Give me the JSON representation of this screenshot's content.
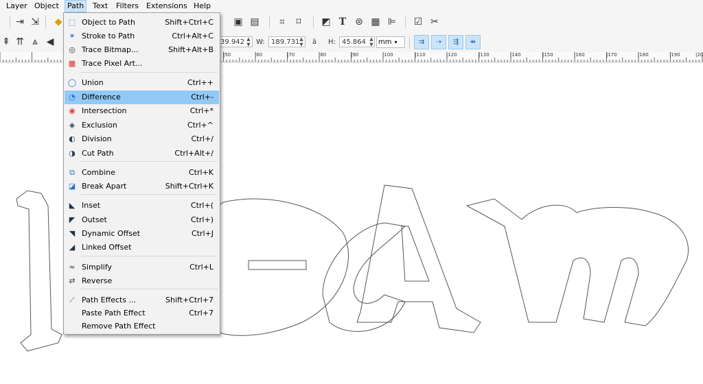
{
  "menubar": {
    "items": [
      {
        "label": "Layer"
      },
      {
        "label": "Object"
      },
      {
        "label": "Path"
      },
      {
        "label": "Text"
      },
      {
        "label": "Filters"
      },
      {
        "label": "Extensions"
      },
      {
        "label": "Help"
      }
    ],
    "active": "Path"
  },
  "toolbar": {
    "x_value": "39.942",
    "w_label": "W:",
    "w_value": "189.731",
    "h_label": "H:",
    "h_value": "45.864",
    "unit": "mm",
    "lock_icon": "lock-icon"
  },
  "ruler": {
    "labels": [
      "|50",
      "|60",
      "|70",
      "|80",
      "|90",
      "|100",
      "|110",
      "|120",
      "|130",
      "|140",
      "|150",
      "|160",
      "|170",
      "|180",
      "|190",
      "|200"
    ]
  },
  "path_menu": {
    "items": [
      {
        "label": "Object to Path",
        "shortcut": "Shift+Ctrl+C",
        "icon": "object-to-path-icon"
      },
      {
        "label": "Stroke to Path",
        "shortcut": "Ctrl+Alt+C",
        "icon": "stroke-to-path-icon"
      },
      {
        "label": "Trace Bitmap...",
        "shortcut": "Shift+Alt+B",
        "icon": "trace-bitmap-icon"
      },
      {
        "label": "Trace Pixel Art...",
        "shortcut": "",
        "icon": "trace-pixel-art-icon"
      },
      {
        "label": "Union",
        "shortcut": "Ctrl++",
        "icon": "union-icon"
      },
      {
        "label": "Difference",
        "shortcut": "Ctrl+-",
        "icon": "difference-icon"
      },
      {
        "label": "Intersection",
        "shortcut": "Ctrl+*",
        "icon": "intersection-icon"
      },
      {
        "label": "Exclusion",
        "shortcut": "Ctrl+^",
        "icon": "exclusion-icon"
      },
      {
        "label": "Division",
        "shortcut": "Ctrl+/",
        "icon": "division-icon"
      },
      {
        "label": "Cut Path",
        "shortcut": "Ctrl+Alt+/",
        "icon": "cut-path-icon"
      },
      {
        "label": "Combine",
        "shortcut": "Ctrl+K",
        "icon": "combine-icon"
      },
      {
        "label": "Break Apart",
        "shortcut": "Shift+Ctrl+K",
        "icon": "break-apart-icon"
      },
      {
        "label": "Inset",
        "shortcut": "Ctrl+(",
        "icon": "inset-icon"
      },
      {
        "label": "Outset",
        "shortcut": "Ctrl+)",
        "icon": "outset-icon"
      },
      {
        "label": "Dynamic Offset",
        "shortcut": "Ctrl+J",
        "icon": "dynamic-offset-icon"
      },
      {
        "label": "Linked Offset",
        "shortcut": "",
        "icon": "linked-offset-icon"
      },
      {
        "label": "Simplify",
        "shortcut": "Ctrl+L",
        "icon": "simplify-icon"
      },
      {
        "label": "Reverse",
        "shortcut": "",
        "icon": "reverse-icon"
      },
      {
        "label": "Path Effects ...",
        "shortcut": "Shift+Ctrl+7",
        "icon": "path-effects-icon"
      },
      {
        "label": "Paste Path Effect",
        "shortcut": "Ctrl+7",
        "icon": ""
      },
      {
        "label": "Remove Path Effect",
        "shortcut": "",
        "icon": ""
      }
    ],
    "highlighted": "Difference"
  },
  "colors": {
    "menu_highlight": "#91c9f7",
    "active_menubar": "#cce4f7",
    "chrome": "#f5f5f5",
    "outline": "#555555"
  }
}
